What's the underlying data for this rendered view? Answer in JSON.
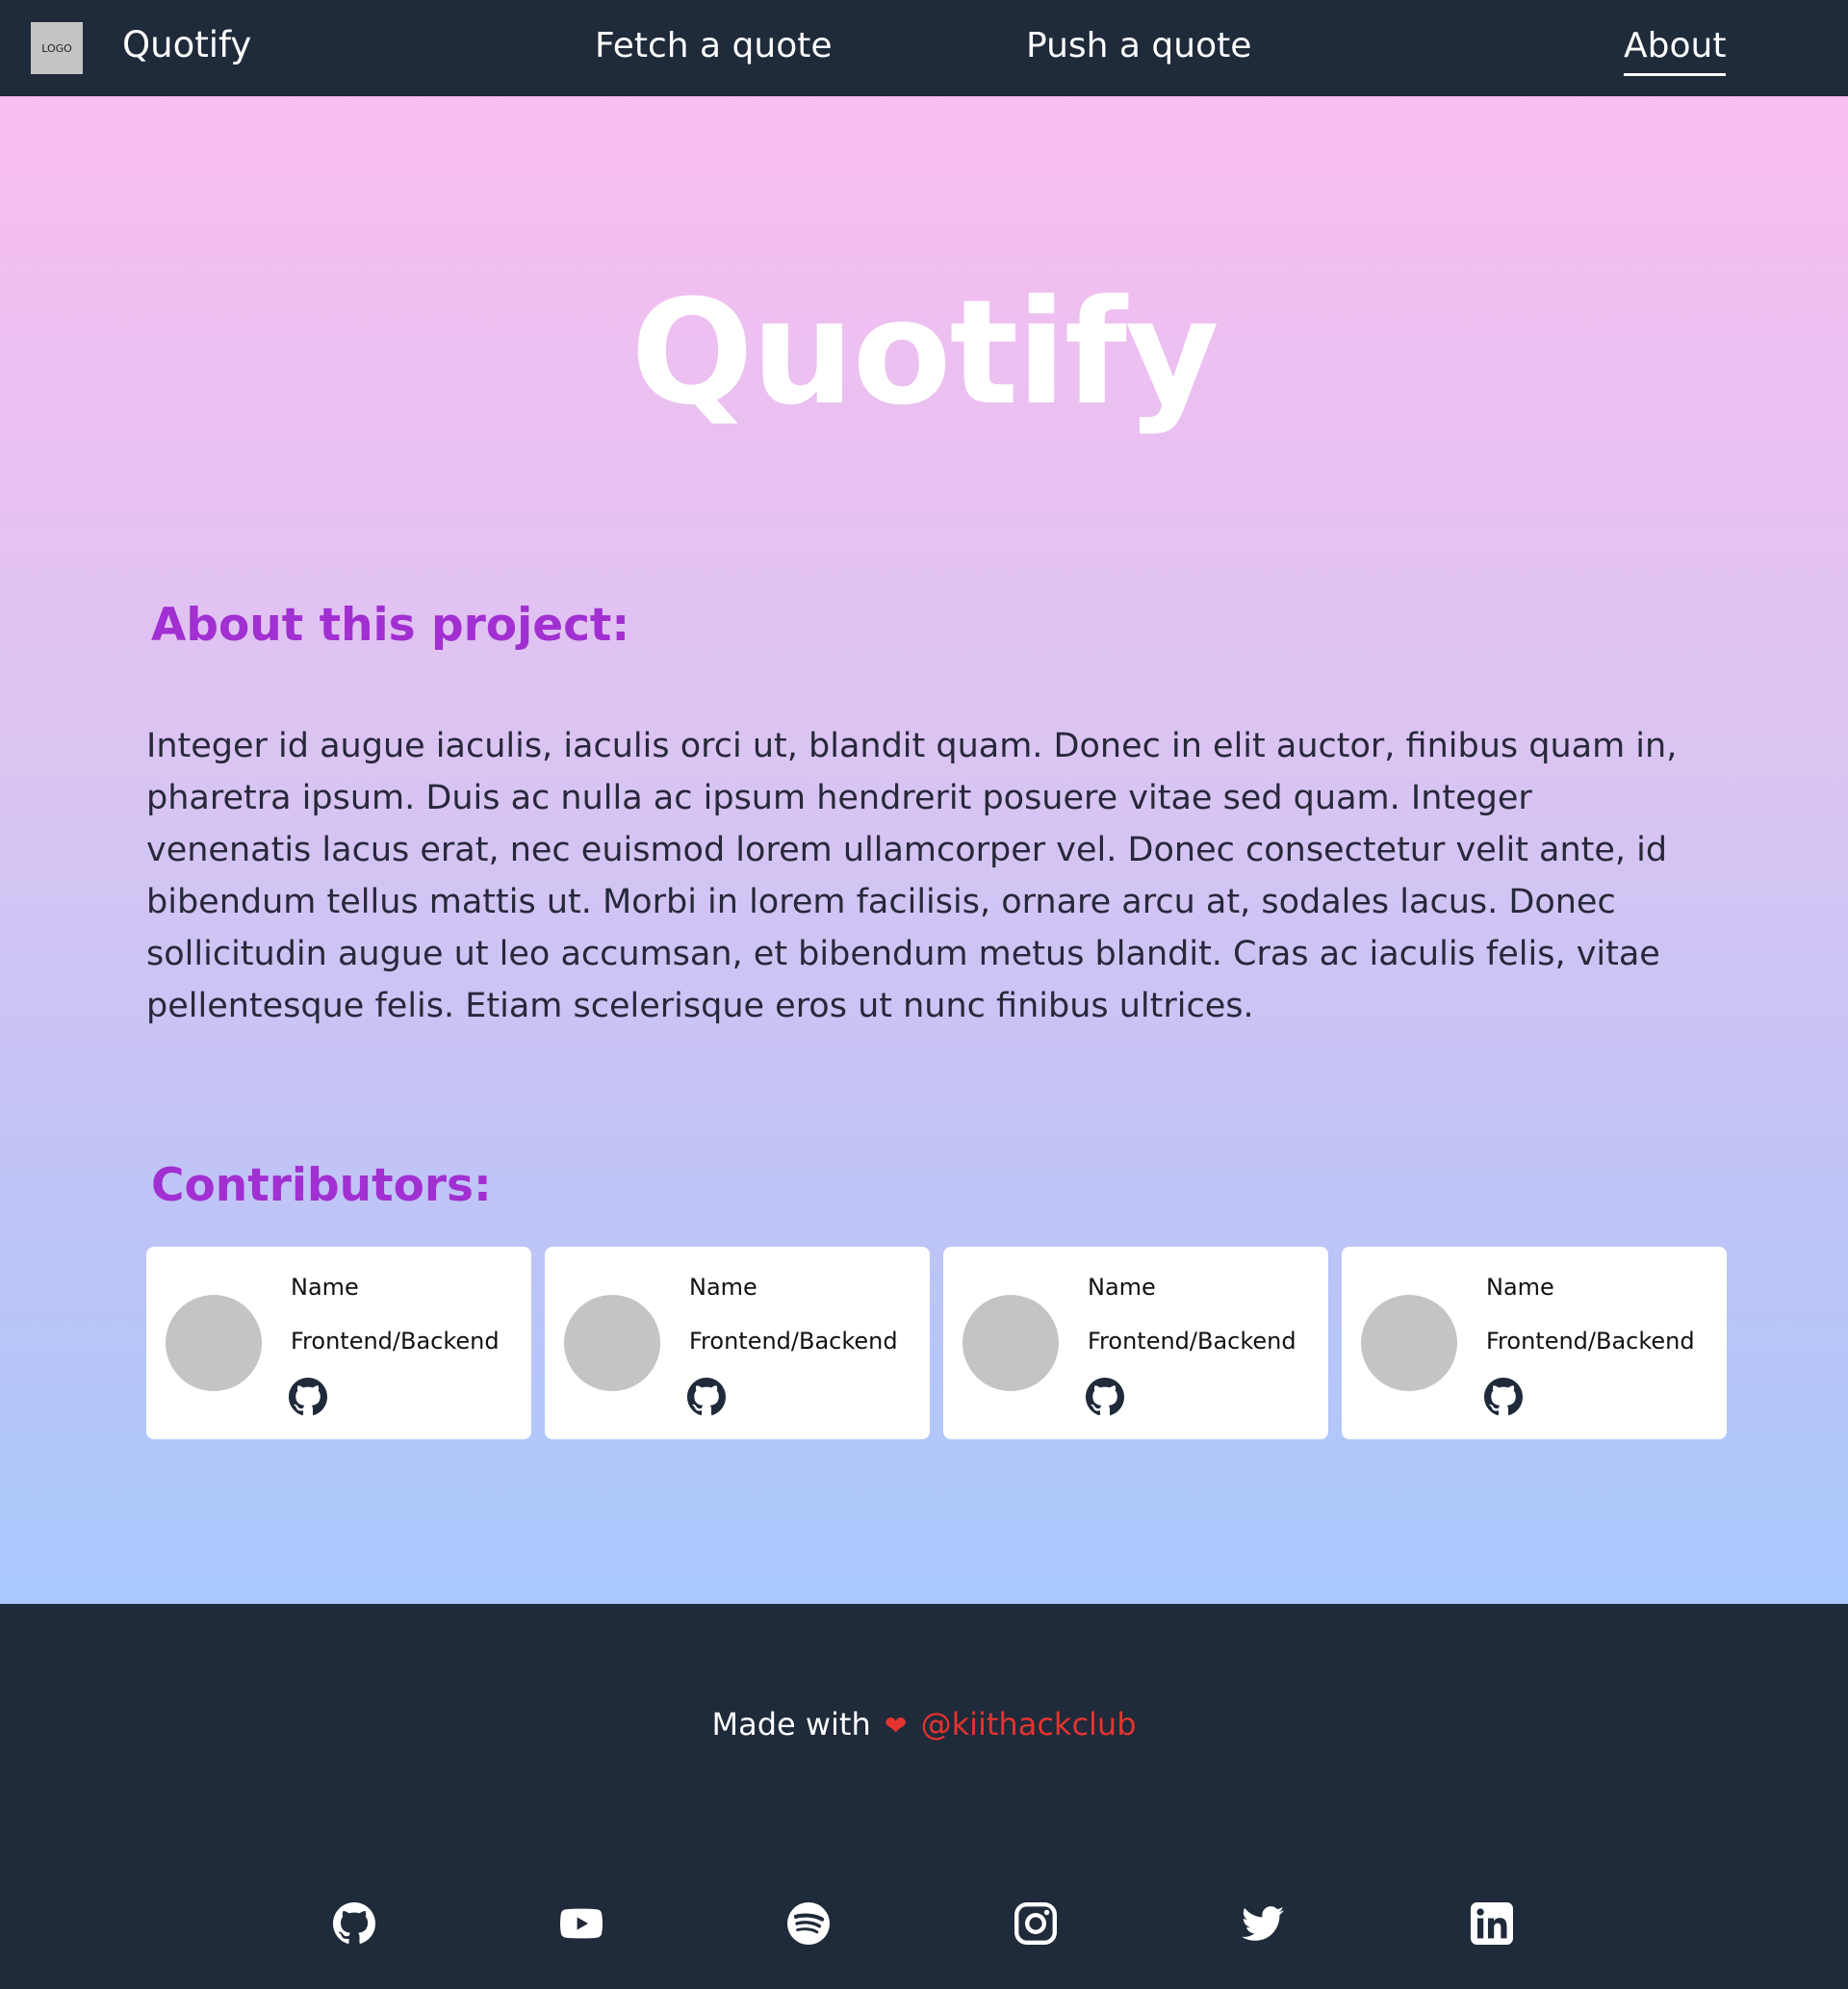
{
  "nav": {
    "logo_text": "LOGO",
    "brand": "Quotify",
    "links": [
      "Fetch a quote",
      "Push a quote",
      "About"
    ]
  },
  "hero": {
    "title": "Quotify"
  },
  "about": {
    "heading": "About this project:",
    "body": "Integer id augue iaculis, iaculis orci ut, blandit quam. Donec in elit auctor, finibus quam in, pharetra ipsum. Duis ac nulla ac ipsum hendrerit posuere vitae sed quam. Integer venenatis lacus erat, nec euismod lorem ullamcorper vel. Donec consectetur velit ante, id bibendum tellus mattis ut. Morbi in lorem facilisis, ornare arcu at, sodales lacus. Donec sollicitudin augue ut leo accumsan, et bibendum metus blandit. Cras ac iaculis felis, vitae pellentesque felis. Etiam scelerisque eros ut nunc finibus ultrices."
  },
  "contributors": {
    "heading": "Contributors:",
    "cards": [
      {
        "name": "Name",
        "role": "Frontend/Backend",
        "icon": "github-icon"
      },
      {
        "name": "Name",
        "role": "Frontend/Backend",
        "icon": "github-icon"
      },
      {
        "name": "Name",
        "role": "Frontend/Backend",
        "icon": "github-icon"
      },
      {
        "name": "Name",
        "role": "Frontend/Backend",
        "icon": "github-icon"
      }
    ]
  },
  "footer": {
    "made_with": "Made with",
    "heart": "❤",
    "club": "@kiithackclub",
    "socials": [
      "github-icon",
      "youtube-icon",
      "spotify-icon",
      "instagram-icon",
      "twitter-icon",
      "linkedin-icon"
    ]
  },
  "colors": {
    "nav_bg": "#1f2a3a",
    "heading_purple": "#a12fd1",
    "link_red": "#e3342f",
    "gradient_top": "#f9bdf0",
    "gradient_bottom": "#a9c9fe"
  }
}
